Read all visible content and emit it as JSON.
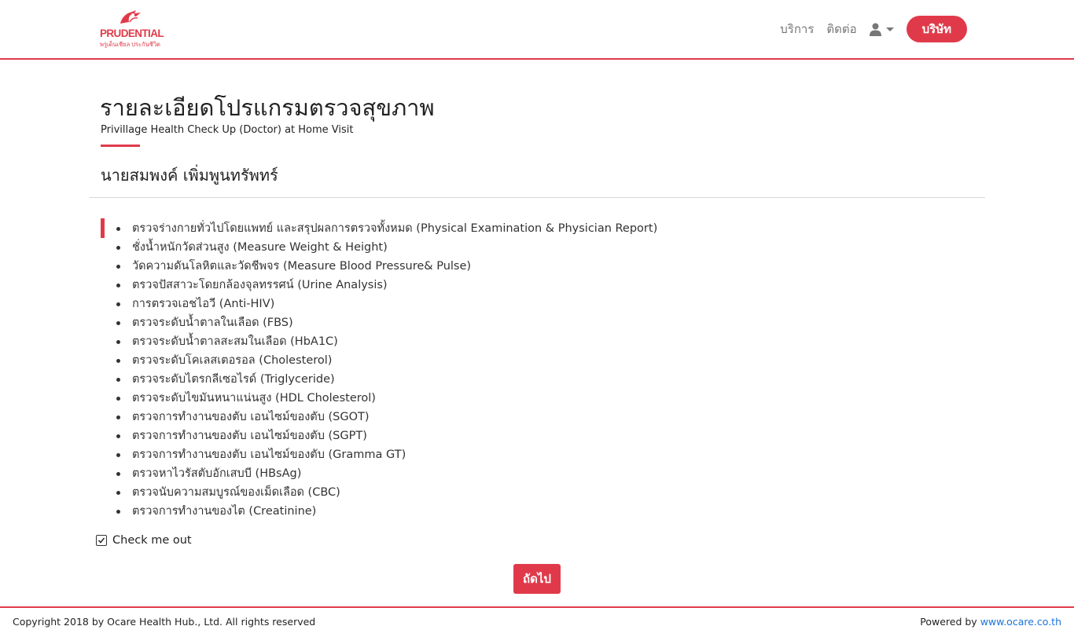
{
  "header": {
    "logo": {
      "brand": "PRUDENTIAL",
      "tagline": "พรูเด็นเชียล ประกันชีวิต"
    },
    "nav": [
      {
        "label": "บริการ"
      },
      {
        "label": "ติดต่อ"
      }
    ],
    "user_icon": "user-icon",
    "company_button": "บริษัท"
  },
  "main": {
    "title": "รายละเอียดโปรแกรมตรวจสุขภาพ",
    "subtitle": "Privillage Health Check Up (Doctor) at Home Visit",
    "member_name": "นายสมพงค์ เพิ่มพูนทรัพทร์",
    "items": [
      "ตรวจร่างกายทั่วไปโดยแพทย์ และสรุปผลการตรวจทั้งหมด (Physical Examination & Physician Report)",
      "ชั่งน้ำหนักวัดส่วนสูง (Measure Weight & Height)",
      "วัดความดันโลหิตและวัดชีพจร (Measure Blood Pressure& Pulse)",
      "ตรวจปัสสาวะโดยกล้องจุลทรรศน์ (Urine Analysis)",
      "การตรวจเอชไอวี (Anti-HIV)",
      "ตรวจระดับน้ำตาลในเลือด (FBS)",
      "ตรวจระดับน้ำตาลสะสมในเลือด (HbA1C)",
      "ตรวจระดับโคเลสเตอรอล (Cholesterol)",
      "ตรวจระดับไตรกลีเซอไรด์ (Triglyceride)",
      "ตรวจระดับไขมันหนาแน่นสูง (HDL Cholesterol)",
      "ตรวจการทำงานของตับ เอนไซม์ของตับ (SGOT)",
      "ตรวจการทำงานของตับ เอนไซม์ของตับ (SGPT)",
      "ตรวจการทำงานของตับ เอนไซม์ของตับ (Gramma GT)",
      "ตรวจหาไวรัสตับอักเสบบี (HBsAg)",
      "ตรวจนับความสมบูรณ์ของเม็ดเลือด (CBC)",
      "ตรวจการทำงานของไต (Creatinine)"
    ],
    "checkbox": {
      "label": "Check me out",
      "checked": true
    },
    "next_button": "ถัดไป"
  },
  "footer": {
    "copyright": "Copyright 2018 by Ocare Health Hub., Ltd. All rights reserved",
    "powered_label": "Powered by",
    "powered_link": "www.ocare.co.th"
  },
  "colors": {
    "accent": "#e03a4a",
    "link": "#1a73d9",
    "text": "#333333"
  }
}
